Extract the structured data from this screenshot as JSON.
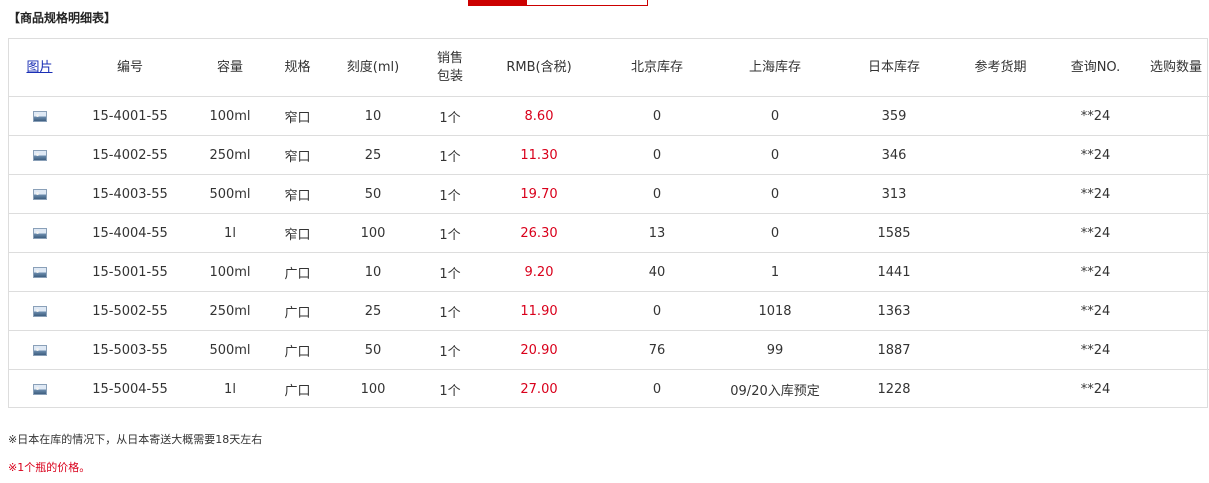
{
  "title": "【商品规格明细表】",
  "columns": {
    "image": "图片",
    "code": "编号",
    "capacity": "容量",
    "spec": "规格",
    "scale": "刻度(ml)",
    "package_line1": "销售",
    "package_line2": "包装",
    "price": "RMB(含税)",
    "beijing": "北京库存",
    "shanghai": "上海库存",
    "japan": "日本库存",
    "delivery": "参考货期",
    "query": "查询NO.",
    "qty": "选购数量"
  },
  "rows": [
    {
      "code": "15-4001-55",
      "capacity": "100ml",
      "spec": "窄口",
      "scale": "10",
      "package": "1个",
      "price": "8.60",
      "beijing": "0",
      "shanghai": "0",
      "japan": "359",
      "delivery": "",
      "query": "**24",
      "qty": ""
    },
    {
      "code": "15-4002-55",
      "capacity": "250ml",
      "spec": "窄口",
      "scale": "25",
      "package": "1个",
      "price": "11.30",
      "beijing": "0",
      "shanghai": "0",
      "japan": "346",
      "delivery": "",
      "query": "**24",
      "qty": ""
    },
    {
      "code": "15-4003-55",
      "capacity": "500ml",
      "spec": "窄口",
      "scale": "50",
      "package": "1个",
      "price": "19.70",
      "beijing": "0",
      "shanghai": "0",
      "japan": "313",
      "delivery": "",
      "query": "**24",
      "qty": ""
    },
    {
      "code": "15-4004-55",
      "capacity": "1l",
      "spec": "窄口",
      "scale": "100",
      "package": "1个",
      "price": "26.30",
      "beijing": "13",
      "shanghai": "0",
      "japan": "1585",
      "delivery": "",
      "query": "**24",
      "qty": ""
    },
    {
      "code": "15-5001-55",
      "capacity": "100ml",
      "spec": "广口",
      "scale": "10",
      "package": "1个",
      "price": "9.20",
      "beijing": "40",
      "shanghai": "1",
      "japan": "1441",
      "delivery": "",
      "query": "**24",
      "qty": ""
    },
    {
      "code": "15-5002-55",
      "capacity": "250ml",
      "spec": "广口",
      "scale": "25",
      "package": "1个",
      "price": "11.90",
      "beijing": "0",
      "shanghai": "1018",
      "japan": "1363",
      "delivery": "",
      "query": "**24",
      "qty": ""
    },
    {
      "code": "15-5003-55",
      "capacity": "500ml",
      "spec": "广口",
      "scale": "50",
      "package": "1个",
      "price": "20.90",
      "beijing": "76",
      "shanghai": "99",
      "japan": "1887",
      "delivery": "",
      "query": "**24",
      "qty": ""
    },
    {
      "code": "15-5004-55",
      "capacity": "1l",
      "spec": "广口",
      "scale": "100",
      "package": "1个",
      "price": "27.00",
      "beijing": "0",
      "shanghai": "09/20入库预定",
      "japan": "1228",
      "delivery": "",
      "query": "**24",
      "qty": ""
    }
  ],
  "notes": {
    "note1": "※日本在库的情况下，从日本寄送大概需要18天左右",
    "note2": "※1个瓶的价格。"
  },
  "colors": {
    "accent": "#cc0000",
    "price": "#d9001b",
    "link": "#1a2fb5",
    "border": "#dddddd"
  },
  "icons": {
    "row_image": "image-thumbnail-icon"
  }
}
